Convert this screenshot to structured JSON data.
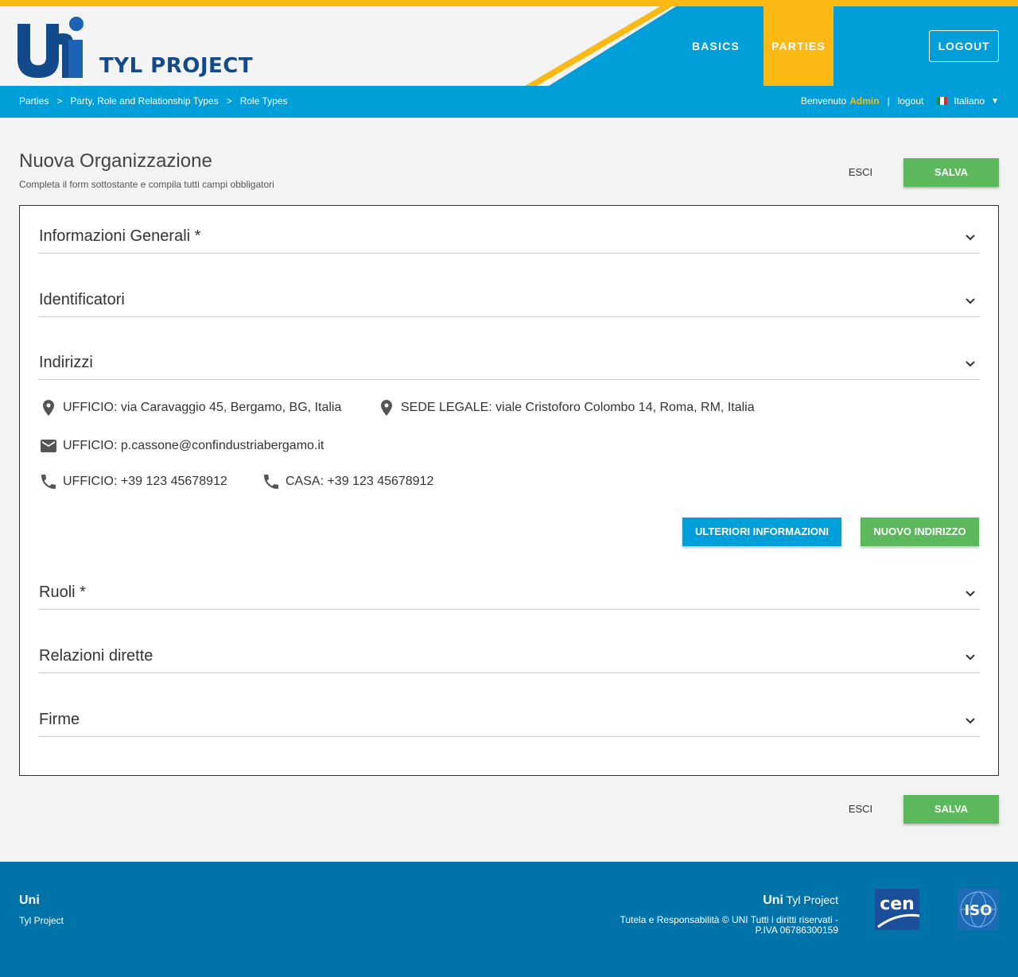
{
  "header": {
    "brand": "TYL PROJECT",
    "nav": [
      "BASICS",
      "PARTIES"
    ],
    "logout_button": "LOGOUT"
  },
  "subbar": {
    "breadcrumb": [
      "Parties",
      "Party, Role and Relationship Types",
      "Role Types"
    ],
    "separator": ">",
    "welcome": "Benvenuto",
    "user": "Admin",
    "pipe": "|",
    "logout_link": "logout",
    "language": "Italiano"
  },
  "page": {
    "title": "Nuova Organizzazione",
    "subtitle": "Completa il form sottostante e compila tutti campi obbligatori",
    "esci": "ESCI",
    "salva": "SALVA"
  },
  "form": {
    "sections": [
      "Informazioni Generali *",
      "Identificatori",
      "Indirizzi",
      "Ruoli *",
      "Relazioni dirette",
      "Firme"
    ],
    "addresses": {
      "address_1": "UFFICIO: via Caravaggio 45, Bergamo, BG, Italia",
      "address_2": "SEDE LEGALE: viale Cristoforo Colombo 14, Roma, RM, Italia",
      "email": "UFFICIO: p.cassone@confindustriabergamo.it",
      "phone_1": "UFFICIO: +39 123 45678912",
      "phone_2": "CASA: +39 123 45678912"
    },
    "more_info_button": "ULTERIORI INFORMAZIONI",
    "new_address_button": "NUOVO INDIRIZZO"
  },
  "footer": {
    "left_title": "Uni",
    "left_sub": "Tyl Project",
    "right_title_bold": "Uni",
    "right_title": "Tyl Project",
    "right_text_1": "Tutela e Responsabilità",
    "right_text_2": "© UNI Tutti i diritti riservati - P.IVA 06786300159",
    "cen_logo": "cen",
    "iso_logo": "ISO"
  },
  "colors": {
    "yellow": "#fdb913",
    "blue": "#009fda",
    "green": "#5cb85c",
    "footer_blue": "#0073a8",
    "brand_navy": "#124a8c"
  }
}
